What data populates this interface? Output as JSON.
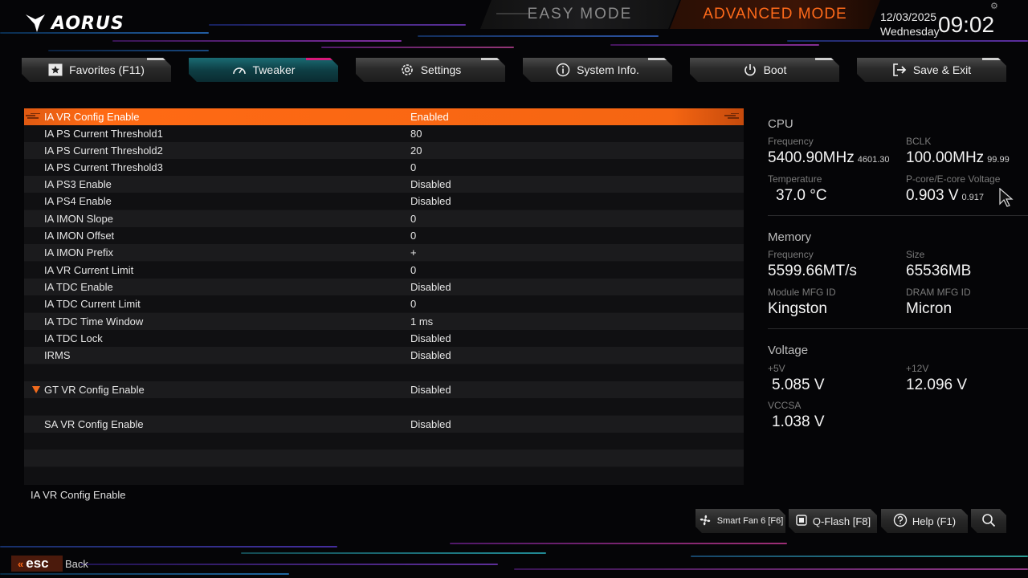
{
  "brand": {
    "logo_text": "AORUS"
  },
  "modes": {
    "easy": "EASY MODE",
    "advanced": "ADVANCED MODE"
  },
  "datetime": {
    "date": "12/03/2025",
    "weekday": "Wednesday",
    "time": "09:02"
  },
  "tabs": [
    {
      "label": "Favorites (F11)",
      "icon": "star-icon",
      "active": false
    },
    {
      "label": "Tweaker",
      "icon": "speedometer-icon",
      "active": true
    },
    {
      "label": "Settings",
      "icon": "gear-icon",
      "active": false
    },
    {
      "label": "System Info.",
      "icon": "info-icon",
      "active": false
    },
    {
      "label": "Boot",
      "icon": "power-icon",
      "active": false
    },
    {
      "label": "Save & Exit",
      "icon": "exit-icon",
      "active": false
    }
  ],
  "settings": [
    {
      "label": "IA VR Config Enable",
      "value": "Enabled"
    },
    {
      "label": "IA PS Current Threshold1",
      "value": "80"
    },
    {
      "label": "IA PS Current Threshold2",
      "value": "20"
    },
    {
      "label": "IA PS Current Threshold3",
      "value": "0"
    },
    {
      "label": "IA PS3 Enable",
      "value": "Disabled"
    },
    {
      "label": "IA PS4 Enable",
      "value": "Disabled"
    },
    {
      "label": "IA IMON Slope",
      "value": "0"
    },
    {
      "label": "IA IMON Offset",
      "value": "0"
    },
    {
      "label": "IA IMON Prefix",
      "value": "+"
    },
    {
      "label": "IA VR Current Limit",
      "value": "0"
    },
    {
      "label": "IA TDC Enable",
      "value": "Disabled"
    },
    {
      "label": "IA TDC Current Limit",
      "value": "0"
    },
    {
      "label": "IA TDC Time Window",
      "value": "1 ms"
    },
    {
      "label": "IA TDC Lock",
      "value": "Disabled"
    },
    {
      "label": "IRMS",
      "value": "Disabled"
    },
    {
      "label": "GT VR Config Enable",
      "value": "Disabled"
    },
    {
      "label": "SA VR Config Enable",
      "value": "Disabled"
    }
  ],
  "help_text": "IA VR Config Enable",
  "system": {
    "cpu": {
      "title": "CPU",
      "freq_label": "Frequency",
      "freq": "5400.90MHz",
      "freq_sub": "4601.30",
      "bclk_label": "BCLK",
      "bclk": "100.00MHz",
      "bclk_sub": "99.99",
      "temp_label": "Temperature",
      "temp": "37.0 °C",
      "volt_label": "P-core/E-core Voltage",
      "volt": "0.903 V",
      "volt_sub": "0.917"
    },
    "memory": {
      "title": "Memory",
      "freq_label": "Frequency",
      "freq": "5599.66MT/s",
      "size_label": "Size",
      "size": "65536MB",
      "module_label": "Module MFG ID",
      "module": "Kingston",
      "dram_label": "DRAM MFG ID",
      "dram": "Micron"
    },
    "voltage": {
      "title": "Voltage",
      "v5_label": "+5V",
      "v5": "5.085 V",
      "v12_label": "+12V",
      "v12": "12.096 V",
      "vccsa_label": "VCCSA",
      "vccsa": "1.038 V"
    }
  },
  "toolbar": {
    "smart_fan": "Smart Fan 6 [F6]",
    "qflash": "Q-Flash [F8]",
    "help": "Help (F1)"
  },
  "footer": {
    "esc_key": "esc",
    "back": "Back"
  },
  "colors": {
    "accent": "#ff6a1a",
    "active_tab": "#0e3f45",
    "active_tab_edge": "#d81a7a"
  }
}
